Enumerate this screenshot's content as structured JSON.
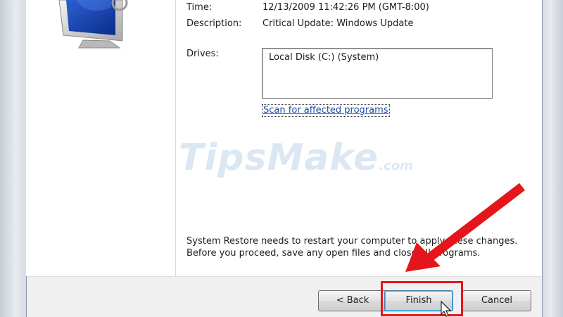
{
  "details": {
    "time_label": "Time:",
    "time_value": "12/13/2009 11:42:26 PM (GMT-8:00)",
    "description_label": "Description:",
    "description_value": "Critical Update: Windows Update",
    "drives_label": "Drives:",
    "drives": [
      "Local Disk (C:) (System)"
    ],
    "scan_link": "Scan for affected programs"
  },
  "notice": {
    "line1": "System Restore needs to restart your computer to apply these changes.",
    "line2": "Before you proceed, save any open files and close all programs."
  },
  "buttons": {
    "back": "< Back",
    "finish": "Finish",
    "cancel": "Cancel"
  },
  "watermark": {
    "brand": "TipsMake",
    "suffix": ".com"
  },
  "colors": {
    "annotation_red": "#e5161b",
    "link_blue": "#1f4ea8"
  },
  "icons": {
    "wizard_graphic": "monitor-icon",
    "annotation": "arrow-icon"
  }
}
